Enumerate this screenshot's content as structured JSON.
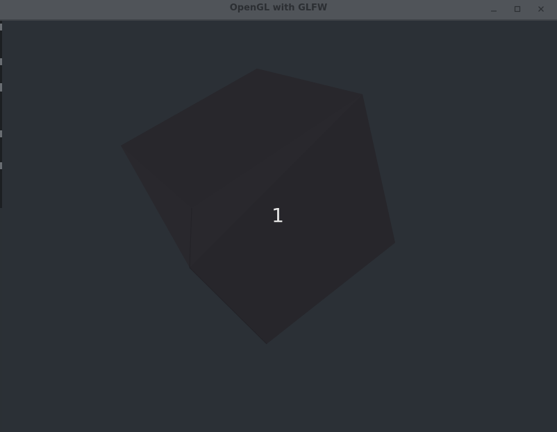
{
  "window": {
    "title": "OpenGL with GLFW",
    "controls": {
      "minimize_icon": "minimize-icon",
      "maximize_icon": "maximize-icon",
      "close_icon": "close-icon"
    }
  },
  "scene": {
    "background_color": "#2b3036",
    "cube_color": "#27262b",
    "cube_label": "1"
  }
}
